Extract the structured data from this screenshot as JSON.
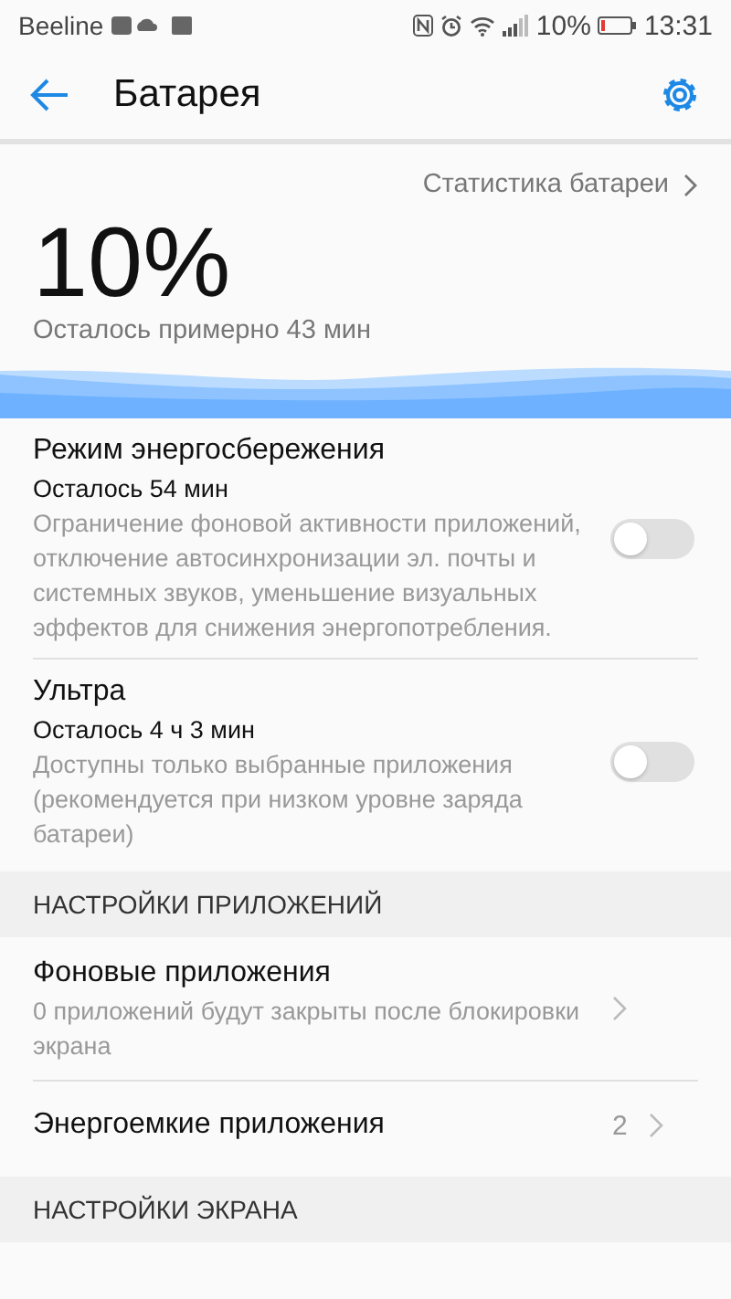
{
  "status_bar": {
    "carrier": "Beeline",
    "battery_text": "10%",
    "time": "13:31"
  },
  "app_bar": {
    "title": "Батарея"
  },
  "stats_link": "Статистика батареи",
  "battery": {
    "percent": "10%",
    "remaining": "Осталось примерно 43 мин"
  },
  "modes": [
    {
      "kind": "toggle",
      "title": "Режим энергосбережения",
      "remaining": "Осталось 54 мин",
      "description": "Ограничение фоновой активности приложений, отключение автосинхронизации эл. почты и системных звуков, уменьшение визуальных эффектов для снижения энергопотребления.",
      "on": false
    },
    {
      "kind": "toggle",
      "title": "Ультра",
      "remaining": "Осталось 4 ч 3 мин",
      "description": "Доступны только выбранные приложения (рекомендуется при низком уровне заряда батареи)",
      "on": false
    }
  ],
  "sections": [
    {
      "header": "НАСТРОЙКИ ПРИЛОЖЕНИЙ",
      "items": [
        {
          "kind": "link",
          "title": "Фоновые приложения",
          "description": "0 приложений будут закрыты после блокировки экрана"
        },
        {
          "kind": "link",
          "title": "Энергоемкие приложения",
          "value": "2"
        }
      ]
    },
    {
      "header": "НАСТРОЙКИ ЭКРАНА"
    }
  ]
}
